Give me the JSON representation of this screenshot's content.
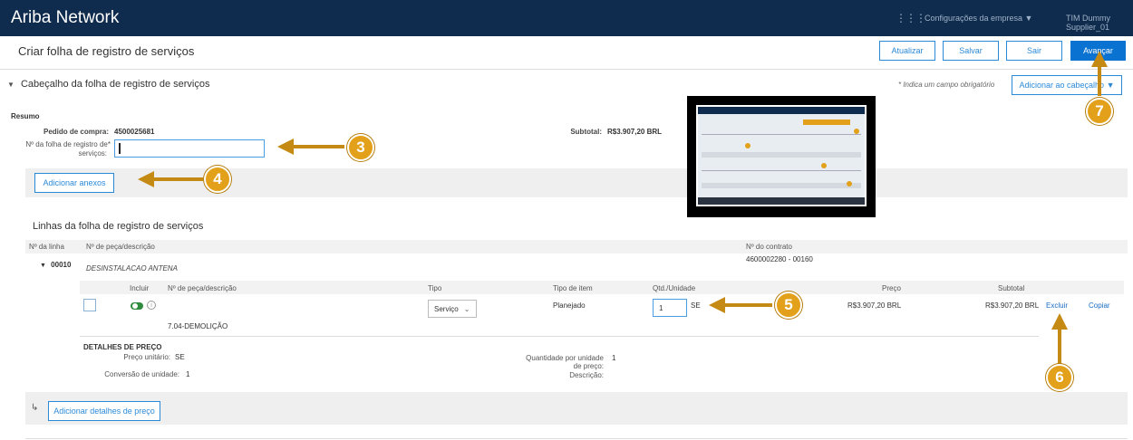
{
  "topbar": {
    "brand": "Ariba Network",
    "grid_icon": "apps-grid-icon",
    "company_menu": "Configurações da empresa ▼",
    "user_menu": "TIM Dummy Supplier_01"
  },
  "title": "Criar folha de registro de serviços",
  "toolbar": {
    "refresh": "Atualizar",
    "save": "Salvar",
    "exit": "Sair",
    "next": "Avançar"
  },
  "header": {
    "section_title": "Cabeçalho da folha de registro de serviços",
    "required_note": "* Indica um campo obrigatório",
    "add_to_header": "Adicionar ao cabeçalho ▼",
    "summary_label": "Resumo",
    "po_label": "Pedido de compra:",
    "po_value": "4500025681",
    "srs_label_1": "Nº da folha de registro de*",
    "srs_label_2": "serviços:",
    "subtotal_label": "Subtotal:",
    "subtotal_value": "R$3.907,20 BRL",
    "add_attachments": "Adicionar anexos"
  },
  "lines": {
    "title": "Linhas da folha de registro de serviços",
    "col_line": "Nº da linha",
    "col_part": "Nº de peça/descrição",
    "col_contract": "Nº do contrato",
    "line_number": "00010",
    "line_desc": "DESINSTALACAO ANTENA",
    "contract_value": "4600002280 - 00160",
    "sub": {
      "col_include": "Incluir",
      "col_part": "Nº de peça/descrição",
      "col_type": "Tipo",
      "col_item_type": "Tipo de item",
      "col_qty": "Qtd./Unidade",
      "col_price": "Preço",
      "col_subtotal": "Subtotal",
      "type_value": "Serviço",
      "item_type_value": "Planejado",
      "qty_value": "1",
      "unit_value": "SE",
      "price_value": "R$3.907,20 BRL",
      "subtotal_value": "R$3.907,20 BRL",
      "delete": "Excluir",
      "copy": "Copiar",
      "service_desc": "7.04-DEMOLIÇÃO"
    },
    "price_details": {
      "title": "DETALHES DE PREÇO",
      "unit_price_label": "Preço unitário:",
      "unit_price_value": "SE",
      "qty_per_unit_label_1": "Quantidade por unidade",
      "qty_per_unit_label_2": "de preço:",
      "qty_per_unit_value": "1",
      "unit_conv_label": "Conversão de unidade:",
      "unit_conv_value": "1",
      "description_label": "Descrição:"
    },
    "add_price_details": "Adicionar detalhes de preço"
  },
  "callouts": [
    "3",
    "4",
    "5",
    "6",
    "7"
  ],
  "colors": {
    "topbar": "#0f2b4d",
    "accent": "#0a72d1",
    "callout": "#e3a11b"
  }
}
